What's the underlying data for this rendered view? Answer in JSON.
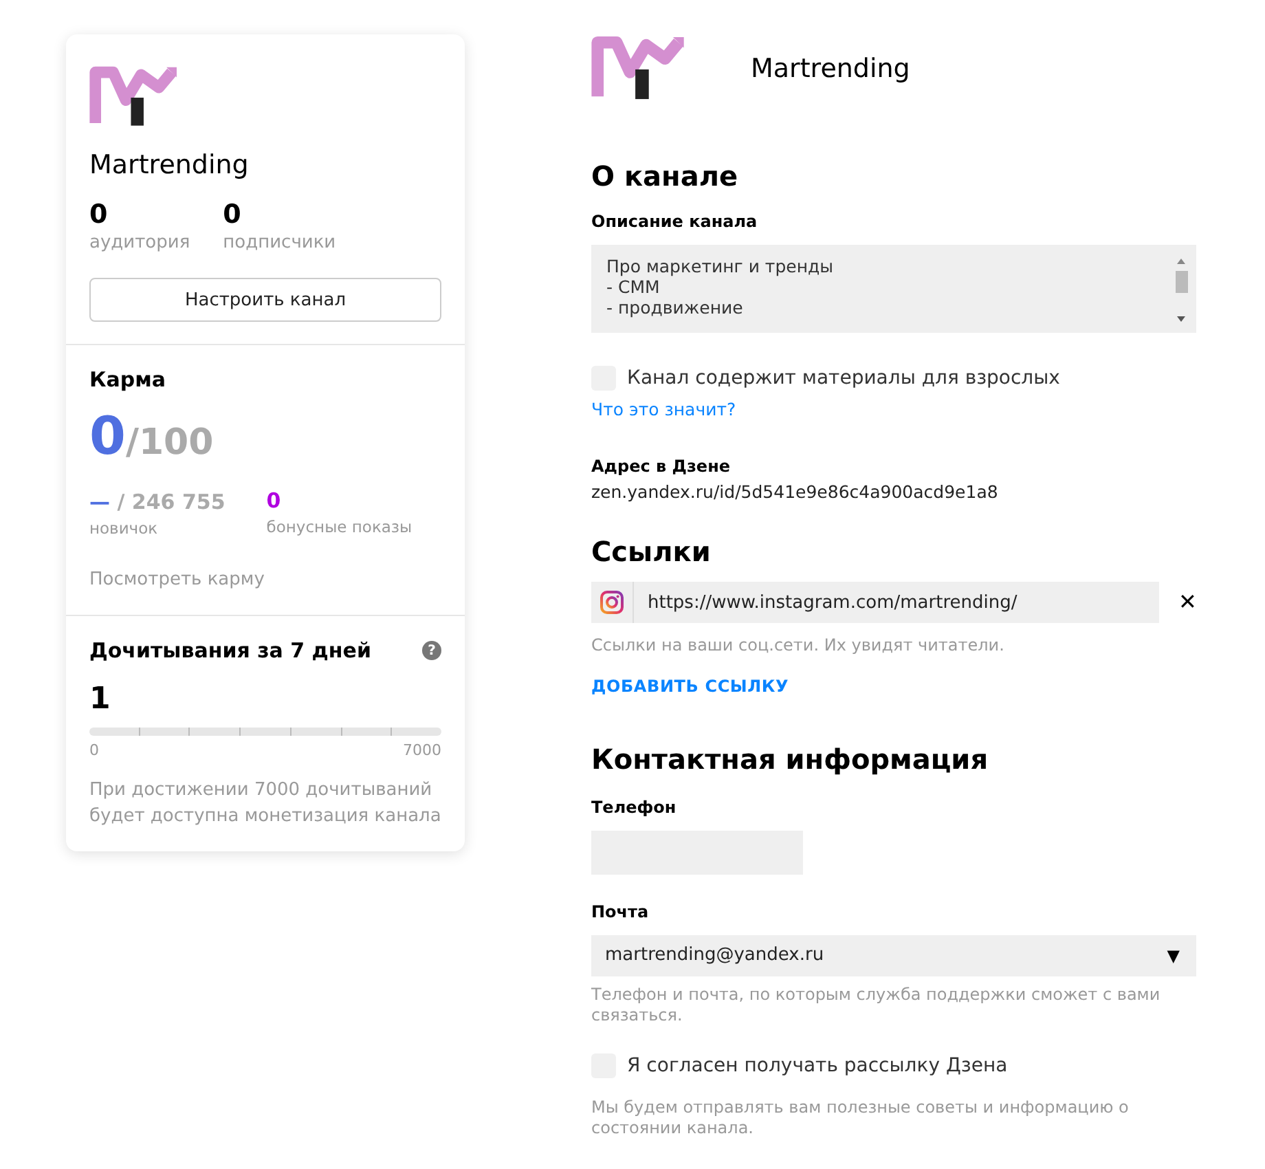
{
  "sidebar": {
    "channel_name": "Martrending",
    "stats": [
      {
        "value": "0",
        "label": "аудитория"
      },
      {
        "value": "0",
        "label": "подписчики"
      }
    ],
    "setup_button": "Настроить канал",
    "karma": {
      "title": "Карма",
      "value": "0",
      "max": "/100",
      "rank_value": "—",
      "rank_total": " / 246 755",
      "rank_label": "новичок",
      "bonus_value": "0",
      "bonus_label": "бонусные показы",
      "link": "Посмотреть карму"
    },
    "reads": {
      "title": "Дочитывания за 7 дней",
      "help": "?",
      "value": "1",
      "level": 0.0001,
      "min": "0",
      "max": "7000",
      "note": "При достижении 7000 дочитываний будет доступна монетизация канала"
    }
  },
  "header": {
    "channel_name": "Martrending"
  },
  "about": {
    "title": "О канале",
    "description_label": "Описание канала",
    "description_lines": [
      "Про маркетинг и тренды",
      "- СММ",
      "- продвижение"
    ],
    "adult_checkbox": {
      "label": "Канал содержит материалы для взрослых",
      "checked": false
    },
    "help_link": "Что это значит?",
    "address_label": "Адрес в Дзене",
    "address": "zen.yandex.ru/id/5d541e9e86c4a900acd9e1a8"
  },
  "links": {
    "title": "Ссылки",
    "items": [
      {
        "url": "https://www.instagram.com/martrending/",
        "remove": "✕"
      }
    ],
    "hint": "Ссылки на ваши соц.сети. Их увидят читатели.",
    "add": "ДОБАВИТЬ ССЫЛКУ"
  },
  "contacts": {
    "title": "Контактная информация",
    "phone_label": "Телефон",
    "email_label": "Почта",
    "email": "martrending@yandex.ru",
    "arrow": "▼",
    "hint": "Телефон и почта, по которым служба поддержки сможет с вами связаться.",
    "newsletter_checkbox": {
      "label": "Я согласен получать рассылку Дзена",
      "checked": false
    },
    "newsletter_hint": "Мы будем отправлять вам полезные советы и информацию о состоянии канала."
  }
}
